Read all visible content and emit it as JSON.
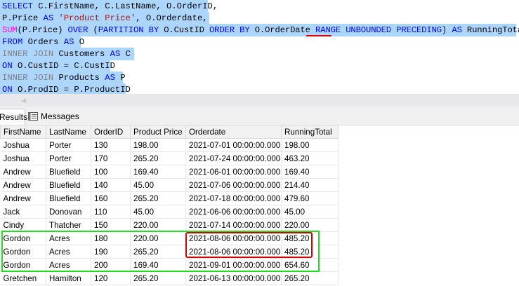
{
  "editor": {
    "line1": {
      "kw1": "SELECT",
      "t1": " C.FirstName, C.LastName, O.OrderID,"
    },
    "line2": {
      "t1": "P.Price ",
      "kw1": "AS",
      "t2": " ",
      "str1": "'Product Price'",
      "t3": ", O.Orderdate,"
    },
    "line3": {
      "fn1": "SUM",
      "t1": "(P.Price) ",
      "kw1": "OVER",
      "t2": " (",
      "kw2": "PARTITION BY",
      "t3": " O.CustID ",
      "kw3": "ORDER BY",
      "t4": " O.OrderDate ",
      "kw4": "RANGE",
      "t5": " ",
      "kw5": "UNBOUNDED PRECEDING",
      "t6": ") ",
      "kw6": "AS",
      "t7": " RunningTotal"
    },
    "line4": {
      "kw1": "FROM",
      "t1": " Orders ",
      "kw2": "AS",
      "t2": " O"
    },
    "line5": {
      "gr1": "INNER JOIN",
      "t1": " Customers ",
      "kw1": "AS",
      "t2": " C"
    },
    "line6": {
      "kw1": "ON",
      "t1": " O.CustID = C.CustID"
    },
    "line7": {
      "gr1": "INNER JOIN",
      "t1": " Products ",
      "kw1": "AS",
      "t2": " P"
    },
    "line8": {
      "kw1": "ON",
      "t1": " O.ProdID = P.ProductID"
    }
  },
  "tabs": {
    "results": "Results",
    "messages": "Messages"
  },
  "grid": {
    "columns": [
      "FirstName",
      "LastName",
      "OrderID",
      "Product Price",
      "Orderdate",
      "RunningTotal"
    ],
    "rows": [
      [
        "Joshua",
        "Porter",
        "130",
        "198.00",
        "2021-07-01 00:00:00.000",
        "198.00"
      ],
      [
        "Joshua",
        "Porter",
        "170",
        "265.20",
        "2021-07-24 00:00:00.000",
        "463.20"
      ],
      [
        "Andrew",
        "Bluefield",
        "100",
        "169.40",
        "2021-06-01 00:00:00.000",
        "169.40"
      ],
      [
        "Andrew",
        "Bluefield",
        "140",
        "45.00",
        "2021-07-06 00:00:00.000",
        "214.40"
      ],
      [
        "Andrew",
        "Bluefield",
        "160",
        "265.20",
        "2021-07-18 00:00:00.000",
        "479.60"
      ],
      [
        "Jack",
        "Donovan",
        "110",
        "45.00",
        "2021-06-06 00:00:00.000",
        "45.00"
      ],
      [
        "Cindy",
        "Thatcher",
        "150",
        "220.00",
        "2021-07-14 00:00:00.000",
        "220.00"
      ],
      [
        "Gordon",
        "Acres",
        "180",
        "220.00",
        "2021-08-06 00:00:00.000",
        "485.20"
      ],
      [
        "Gordon",
        "Acres",
        "190",
        "265.20",
        "2021-08-06 00:00:00.000",
        "485.20"
      ],
      [
        "Gordon",
        "Acres",
        "200",
        "169.40",
        "2021-09-01 00:00:00.000",
        "654.60"
      ],
      [
        "Gretchen",
        "Hamilton",
        "120",
        "265.20",
        "2021-06-13 00:00:00.000",
        "265.20"
      ]
    ]
  },
  "colors": {
    "selection": "#add6ff",
    "keyword": "#0000ff",
    "string": "#a31515",
    "function": "#ff00ff",
    "green_box": "#22dd22",
    "red_box": "#d40000"
  }
}
